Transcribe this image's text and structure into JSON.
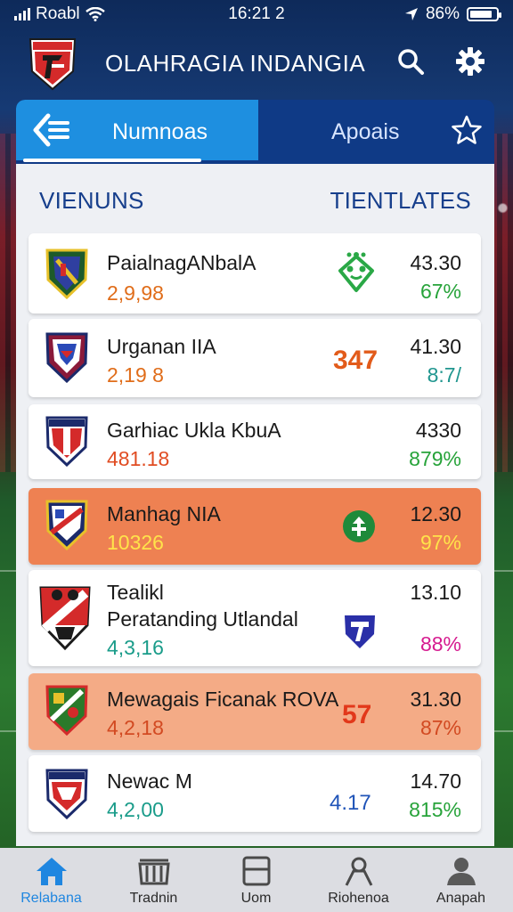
{
  "status_bar": {
    "carrier": "Roabl",
    "time": "16:21 2",
    "battery": "86%",
    "battery_level": 0.86
  },
  "header": {
    "title": "OLAHRAGIA INDANGIA"
  },
  "tabs": {
    "active_label": "Numnoas",
    "inactive_label": "Apoais"
  },
  "columns": {
    "left": "VIENUNS",
    "right": "TIENTLATES"
  },
  "matches": [
    {
      "name": "PaialnagANbalA",
      "sub": "2,9,98",
      "sub_color": "#e06d1a",
      "mid_text": "",
      "mid_icon": "green-alien-icon",
      "odds": "43.30",
      "pct": "67%",
      "pct_color": "#27a33a",
      "style": "white"
    },
    {
      "name": "Urganan IIA",
      "sub": "2,19 8",
      "sub_color": "#e06d1a",
      "mid_text": "347",
      "mid_color": "#e25b1a",
      "odds": "41.30",
      "pct": "8:7/",
      "pct_color": "#20968f",
      "style": "white"
    },
    {
      "name": "Garhiac Ukla KbuA",
      "sub": "481.18",
      "sub_color": "#e04c22",
      "mid_text": "",
      "odds": "4330",
      "pct": "879%",
      "pct_color": "#27a33a",
      "style": "white"
    },
    {
      "name": "Manhag NIA",
      "sub": "10326",
      "sub_color": "#ffe34a",
      "mid_text": "",
      "mid_icon": "green-plus-badge-icon",
      "odds": "12.30",
      "pct": "97%",
      "pct_color": "#ffe34a",
      "style": "orange"
    },
    {
      "name": "Tealikl",
      "name2": "Peratanding Utlandal",
      "sub": "4,3,16",
      "sub_color": "#1a9c8a",
      "mid_text": "",
      "mid_icon": "blue-shield-icon",
      "odds": "13.10",
      "pct": "88%",
      "pct_color": "#d61a8f",
      "style": "white"
    },
    {
      "name": "Mewagais Ficanak ROVA",
      "sub": "4,2,18",
      "sub_color": "#d24a22",
      "mid_text": "57",
      "mid_color": "#e2381a",
      "odds": "31.30",
      "pct": "87%",
      "pct_color": "#d24a22",
      "style": "peach"
    },
    {
      "name": "Newac M",
      "sub": "4,2,00",
      "sub_color": "#1a9c8a",
      "mid_text": "4.17",
      "mid_color": "#2054b8",
      "odds": "14.70",
      "pct": "815%",
      "pct_color": "#27a33a",
      "style": "white"
    }
  ],
  "bottom_nav": [
    {
      "label": "Relabana",
      "icon": "home-icon",
      "active": true
    },
    {
      "label": "Tradnin",
      "icon": "stadium-icon",
      "active": false
    },
    {
      "label": "Uom",
      "icon": "tablet-icon",
      "active": false
    },
    {
      "label": "Riohenoa",
      "icon": "person-outline-icon",
      "active": false
    },
    {
      "label": "Anapah",
      "icon": "user-icon",
      "active": false
    }
  ]
}
